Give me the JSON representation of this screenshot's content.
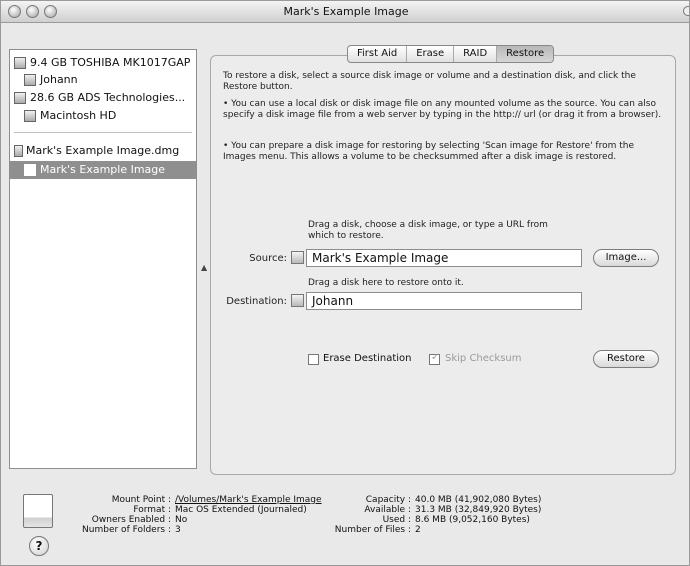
{
  "window": {
    "title": "Mark's Example Image"
  },
  "sidebar": {
    "items": [
      {
        "label": "9.4 GB TOSHIBA MK1017GAP",
        "icon": "hard-disk-icon",
        "indent": 0,
        "selected": false
      },
      {
        "label": "Johann",
        "icon": "volume-icon",
        "indent": 1,
        "selected": false
      },
      {
        "label": "28.6 GB ADS Technologies...",
        "icon": "hard-disk-icon",
        "indent": 0,
        "selected": false
      },
      {
        "label": "Macintosh HD",
        "icon": "volume-icon",
        "indent": 1,
        "selected": false
      },
      {
        "label": "Mark's Example Image.dmg",
        "icon": "disk-image-icon",
        "indent": 0,
        "selected": false
      },
      {
        "label": "Mark's Example Image",
        "icon": "volume-icon",
        "indent": 1,
        "selected": true
      }
    ]
  },
  "tabs": [
    "First Aid",
    "Erase",
    "RAID",
    "Restore"
  ],
  "active_tab": "Restore",
  "restore": {
    "intro": "To restore a disk, select a source disk image or volume and a destination disk, and click the Restore button.",
    "bullet1": "• You can use a local disk or disk image file on any mounted volume as the source. You can also specify a disk image file from a web server by typing in the http:// url (or drag it from a browser).",
    "bullet2": "• You can prepare a disk image for restoring by selecting 'Scan image for Restore' from the Images menu. This allows a volume to be checksummed after a disk image is restored.",
    "source_hint": "Drag a disk, choose a disk image, or type a URL from which to restore.",
    "source_label": "Source:",
    "source_value": "Mark's Example Image",
    "image_button": "Image...",
    "dest_hint": "Drag a disk here to restore onto it.",
    "dest_label": "Destination:",
    "dest_value": "Johann",
    "erase_destination": {
      "label": "Erase Destination",
      "checked": false
    },
    "skip_checksum": {
      "label": "Skip Checksum",
      "checked": true,
      "enabled": false
    },
    "restore_button": "Restore"
  },
  "info": {
    "mount_point_k": "Mount Point :",
    "mount_point_v": "/Volumes/Mark's Example Image",
    "format_k": "Format :",
    "format_v": "Mac OS Extended (Journaled)",
    "owners_k": "Owners Enabled :",
    "owners_v": "No",
    "folders_k": "Number of Folders :",
    "folders_v": "3",
    "capacity_k": "Capacity :",
    "capacity_v": "40.0 MB (41,902,080 Bytes)",
    "available_k": "Available :",
    "available_v": "31.3 MB (32,849,920 Bytes)",
    "used_k": "Used :",
    "used_v": "8.6 MB (9,052,160 Bytes)",
    "files_k": "Number of Files :",
    "files_v": "2"
  },
  "help_symbol": "?"
}
